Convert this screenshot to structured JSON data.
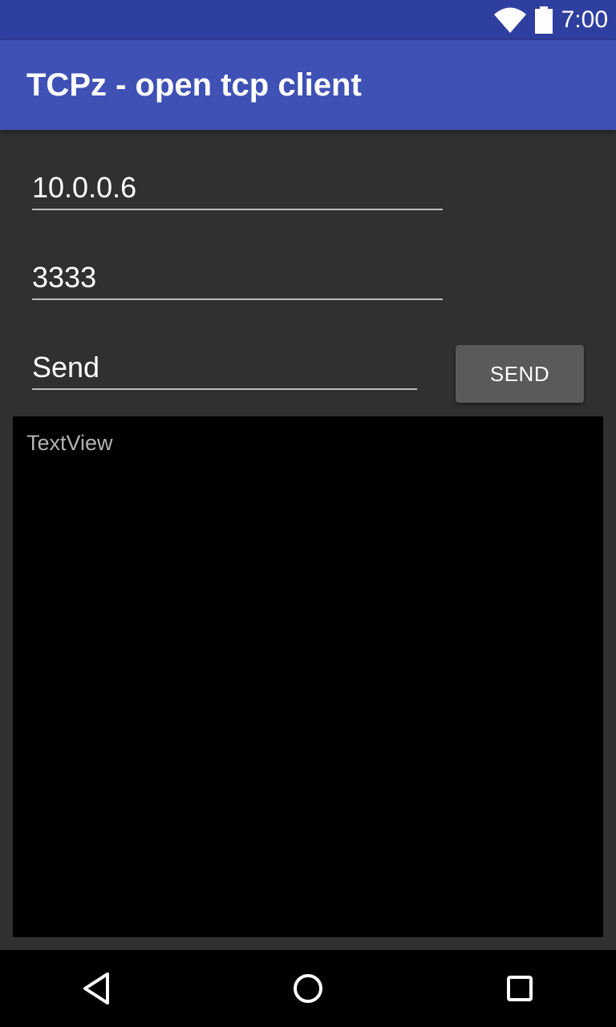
{
  "status_bar": {
    "time": "7:00",
    "icons": [
      "wifi-icon",
      "battery-icon"
    ]
  },
  "app_bar": {
    "title": "TCPz - open tcp client"
  },
  "form": {
    "host_value": "10.0.0.6",
    "port_value": "3333",
    "message_value": "Send",
    "send_button_label": "SEND"
  },
  "output": {
    "text": "TextView"
  },
  "nav_bar": {
    "icons": [
      "back-icon",
      "home-icon",
      "recents-icon"
    ]
  },
  "colors": {
    "status_bar": "#2f3f9f",
    "app_bar": "#3f51b5",
    "background": "#303030",
    "button": "#5a5a5a",
    "output_background": "#000000"
  }
}
